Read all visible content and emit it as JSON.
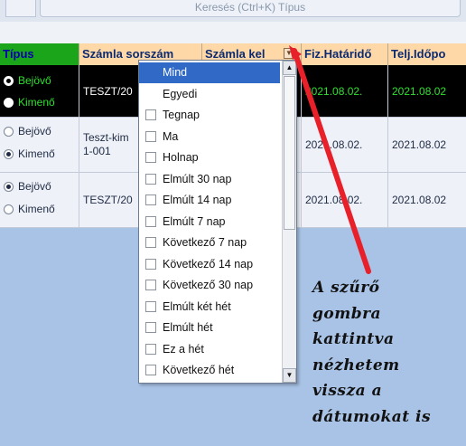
{
  "toolbar": {
    "search_placeholder": "Keresés (Ctrl+K) Típus"
  },
  "grid": {
    "columns": [
      "Típus",
      "Számla sorszám",
      "Számla kel",
      "Fiz.Határidő",
      "Telj.Időpo"
    ],
    "rows": [
      {
        "radio_in": "Bejövő",
        "radio_out": "Kimenő",
        "selected": "Bejövő",
        "sorszam": "TESZT/20",
        "fiz": "2021.08.02.",
        "telj": "2021.08.02"
      },
      {
        "radio_in": "Bejövő",
        "radio_out": "Kimenő",
        "selected": "Kimenő",
        "sorszam": "Teszt-kim\n1-001",
        "fiz": "2021.08.02.",
        "telj": "2021.08.02"
      },
      {
        "radio_in": "Bejövő",
        "radio_out": "Kimenő",
        "selected": "Bejövő",
        "sorszam": "TESZT/20",
        "fiz": "2021.08.02.",
        "telj": "2021.08.02"
      }
    ]
  },
  "filter_dropdown": {
    "items": [
      "Mind",
      "Egyedi",
      "Tegnap",
      "Ma",
      "Holnap",
      "Elmúlt 30 nap",
      "Elmúlt 14 nap",
      "Elmúlt 7 nap",
      "Következő 7 nap",
      "Következő 14 nap",
      "Következő 30 nap",
      "Elmúlt két hét",
      "Elmúlt hét",
      "Ez a hét",
      "Következő hét"
    ],
    "selected": "Mind"
  },
  "annotation": {
    "lines": [
      "A szűrő",
      "gombra",
      "kattintva",
      "nézhetem",
      "vissza a",
      "dátumokat is"
    ],
    "arrow_color": "#e8202a"
  },
  "colors": {
    "header_bg": "#ffd8a8",
    "selected_item": "#3169c6",
    "tipus_header": "#1aa51a"
  }
}
